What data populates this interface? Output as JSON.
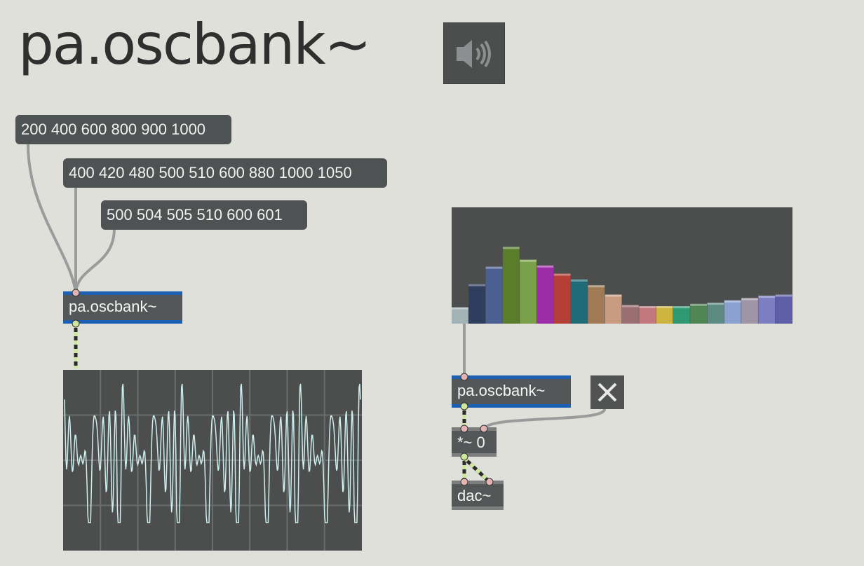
{
  "title": "pa.oscbank~",
  "speaker": {
    "icon": "speaker-icon"
  },
  "messages": [
    {
      "id": "msg-1",
      "label": "200 400 600 800 900 1000"
    },
    {
      "id": "msg-2",
      "label": "400 420 480 500 510 600 880 1000 1050"
    },
    {
      "id": "msg-3",
      "label": "500 504 505 510 600 601"
    }
  ],
  "objects": {
    "oscbank_left": "pa.oscbank~",
    "oscbank_right": "pa.oscbank~",
    "multiply": "*~ 0",
    "dac": "dac~"
  },
  "toggle": {
    "state": "on",
    "icon": "close-icon"
  },
  "multislider": {
    "count": 20,
    "values": [
      0.14,
      0.34,
      0.49,
      0.66,
      0.55,
      0.5,
      0.43,
      0.38,
      0.33,
      0.25,
      0.16,
      0.15,
      0.15,
      0.15,
      0.17,
      0.18,
      0.2,
      0.22,
      0.24,
      0.25
    ],
    "colors": [
      "#a4b3b5",
      "#2f3d5e",
      "#4a5f92",
      "#5a7d2c",
      "#7aa14a",
      "#9b2ea7",
      "#b53f36",
      "#1f6b78",
      "#a07a55",
      "#c99c82",
      "#9b6e72",
      "#c2787e",
      "#cdb43f",
      "#2f9a72",
      "#4f8654",
      "#5c8b84",
      "#8ba1cf",
      "#9f95a7",
      "#7d7ec1",
      "#5e5ea6"
    ]
  },
  "colors": {
    "background": "#dfe0d9",
    "signal_inlet": "#1d5fb3",
    "patch_cord_signal": "#cfe79a",
    "scope_wave": "#cfeeee"
  }
}
